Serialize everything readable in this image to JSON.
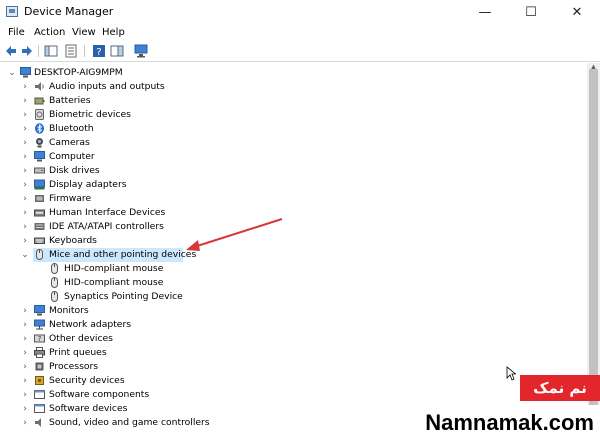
{
  "window": {
    "title": "Device Manager",
    "minimize_glyph": "—",
    "maximize_glyph": "☐",
    "close_glyph": "✕"
  },
  "menu": [
    "File",
    "Action",
    "View",
    "Help"
  ],
  "tree": {
    "root": "DESKTOP-AIG9MPM",
    "items": [
      {
        "label": "Audio inputs and outputs",
        "icon": "speaker-icon"
      },
      {
        "label": "Batteries",
        "icon": "battery-icon"
      },
      {
        "label": "Biometric devices",
        "icon": "fingerprint-icon"
      },
      {
        "label": "Bluetooth",
        "icon": "bluetooth-icon"
      },
      {
        "label": "Cameras",
        "icon": "camera-icon"
      },
      {
        "label": "Computer",
        "icon": "monitor-icon"
      },
      {
        "label": "Disk drives",
        "icon": "disk-icon"
      },
      {
        "label": "Display adapters",
        "icon": "display-adapter-icon"
      },
      {
        "label": "Firmware",
        "icon": "chip-icon"
      },
      {
        "label": "Human Interface Devices",
        "icon": "hid-icon"
      },
      {
        "label": "IDE ATA/ATAPI controllers",
        "icon": "controller-icon"
      },
      {
        "label": "Keyboards",
        "icon": "keyboard-icon"
      },
      {
        "label": "Mice and other pointing devices",
        "icon": "mouse-icon",
        "expanded": true,
        "children": [
          "HID-compliant mouse",
          "HID-compliant mouse",
          "Synaptics Pointing Device"
        ]
      },
      {
        "label": "Monitors",
        "icon": "monitor-icon"
      },
      {
        "label": "Network adapters",
        "icon": "network-icon"
      },
      {
        "label": "Other devices",
        "icon": "question-device-icon"
      },
      {
        "label": "Print queues",
        "icon": "printer-icon"
      },
      {
        "label": "Processors",
        "icon": "cpu-icon"
      },
      {
        "label": "Security devices",
        "icon": "security-icon"
      },
      {
        "label": "Software components",
        "icon": "software-icon"
      },
      {
        "label": "Software devices",
        "icon": "software-icon"
      },
      {
        "label": "Sound, video and game controllers",
        "icon": "speaker-icon"
      }
    ]
  },
  "watermark": {
    "badge": "نم نمک",
    "site": "Namnamak.com"
  },
  "colors": {
    "selection": "#cce8ff",
    "annotation_arrow": "#d9363a",
    "watermark_red": "#e3262b"
  }
}
